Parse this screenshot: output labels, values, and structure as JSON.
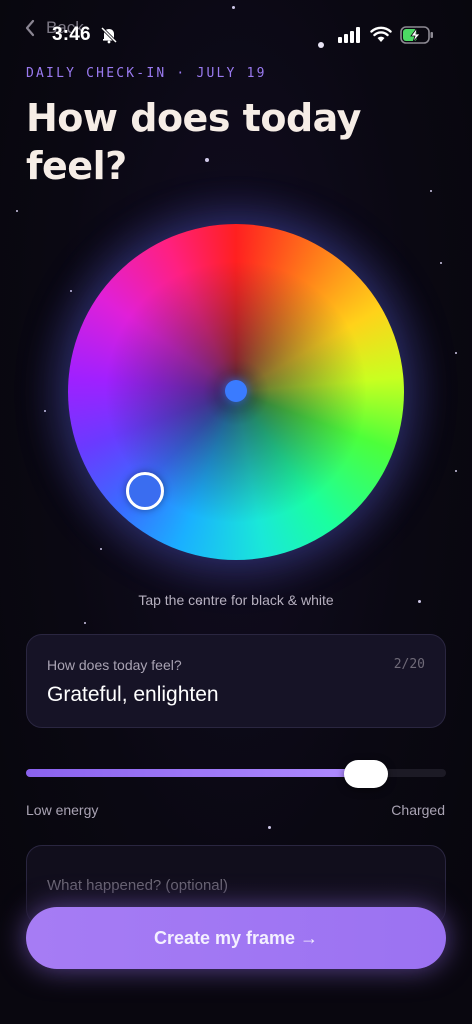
{
  "status_bar": {
    "back_label": "Back",
    "time": "3:46",
    "icons": [
      "chevron-left-icon",
      "bell-off-icon",
      "cellular-signal-icon",
      "wifi-icon",
      "battery-charging-icon"
    ]
  },
  "header": {
    "eyebrow": "DAILY CHECK-IN · JULY 19",
    "title": "How does today feel?"
  },
  "color_wheel": {
    "selected_color": "#3a6df0",
    "center_color": "#3a7bff",
    "hint": "Tap the centre for black & white"
  },
  "mood_input": {
    "label": "How does today feel?",
    "value": "Grateful, enlighten",
    "counter": "2/20"
  },
  "energy": {
    "level_percent": 81,
    "low_label": "Low energy",
    "high_label": "Charged"
  },
  "notes": {
    "placeholder": "What happened? (optional)"
  },
  "cta": {
    "label": "Create my frame →"
  },
  "colors": {
    "accent": "#a67cf4",
    "eyebrow": "#9a7af0",
    "background": "#09070f"
  }
}
